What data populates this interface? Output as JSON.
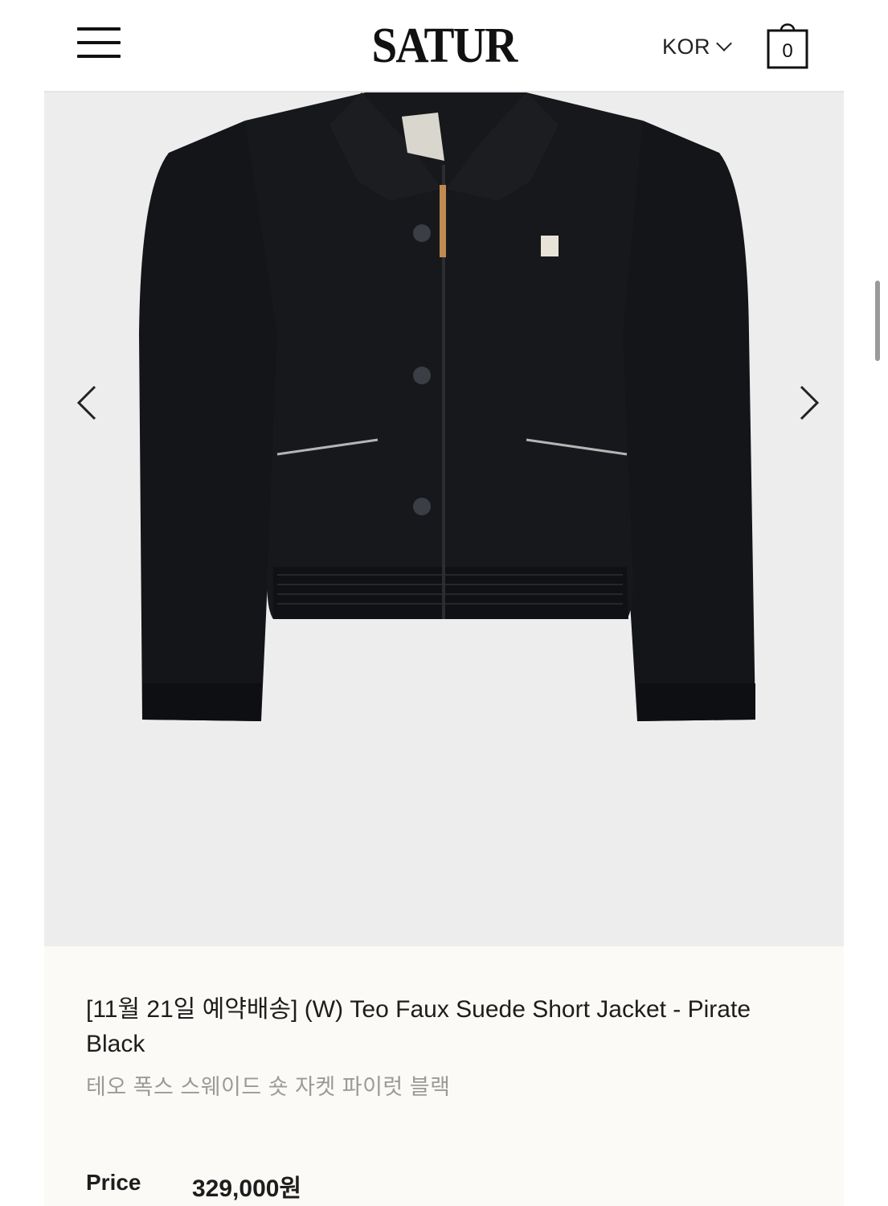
{
  "header": {
    "logo": "SATUR",
    "language": "KOR",
    "cart_count": "0"
  },
  "gallery": {
    "image_alt": "Teo Faux Suede Short Jacket - Pirate Black",
    "background": "#ededed",
    "prev_icon": "chevron-left-icon",
    "next_icon": "chevron-right-icon"
  },
  "product": {
    "title": "[11월 21일 예약배송] (W) Teo Faux Suede Short Jacket - Pirate Black",
    "subtitle": "테오 폭스 스웨이드 숏 자켓 파이럿 블랙",
    "price_label": "Price",
    "price_value": "329,000원"
  },
  "colors": {
    "info_bg": "#fbfaf6",
    "text": "#1d1d1d",
    "muted": "#9a9a9a"
  }
}
